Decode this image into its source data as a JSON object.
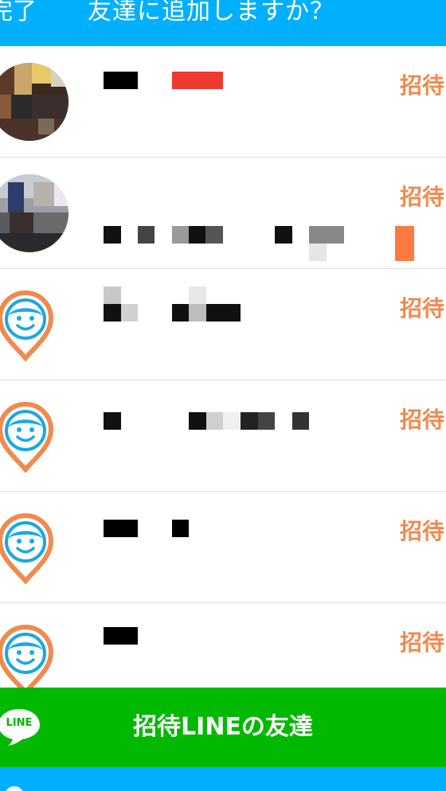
{
  "header": {
    "done_label": "完了",
    "title": "友達に追加しますか？"
  },
  "rows": [
    {
      "avatar": "photo",
      "invite_label": "招待"
    },
    {
      "avatar": "photo",
      "invite_label": "招待"
    },
    {
      "avatar": "default-pin-icon",
      "invite_label": "招待"
    },
    {
      "avatar": "default-pin-icon",
      "invite_label": "招待"
    },
    {
      "avatar": "default-pin-icon",
      "invite_label": "招待"
    },
    {
      "avatar": "default-pin-icon",
      "invite_label": "招待"
    }
  ],
  "line_bar": {
    "logo_text": "LINE",
    "label": "招待LINEの友達"
  },
  "colors": {
    "header": "#00b0ff",
    "invite": "#f08a4e",
    "line_green": "#00b900",
    "pin_orange": "#f08a4e",
    "face_blue": "#1aa7e6"
  }
}
